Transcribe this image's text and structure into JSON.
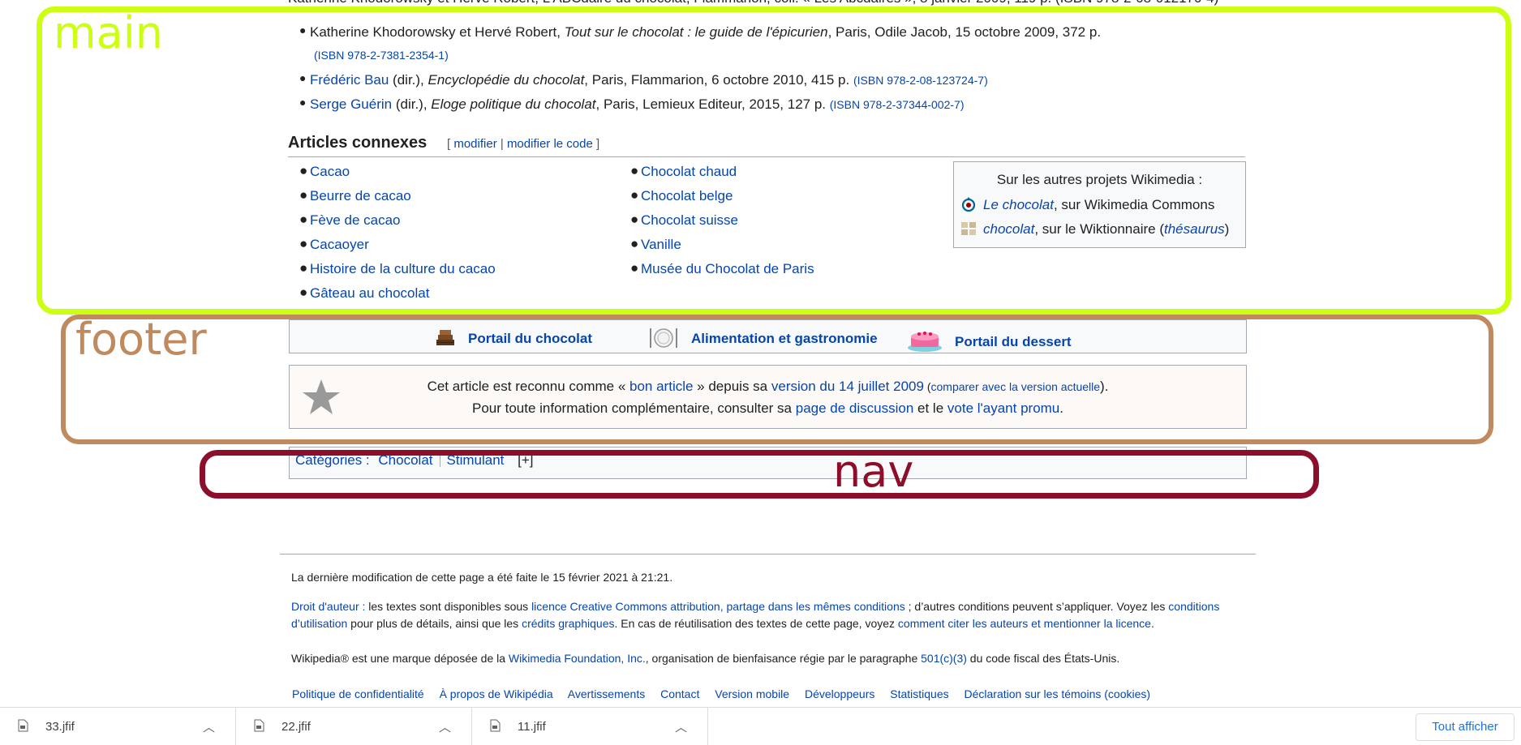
{
  "references": {
    "cut_line": "Katherine Khodorowsky et Hervé Robert, L'ABCdaire du chocolat, Flammarion, coll. « Les Abcdaires », 8 janvier 2009, 119 p. (ISBN 978-2-08-012170-4)",
    "items": [
      {
        "pre": "Katherine Khodorowsky et Hervé Robert, ",
        "title": "Tout sur le chocolat : le guide de l'épicurien",
        "post": ", Paris, Odile Jacob, 15 octobre 2009, 372 p.",
        "isbn": "(ISBN 978-2-7381-2354-1)"
      },
      {
        "author": "Frédéric Bau",
        "pre": " (dir.), ",
        "title": "Encyclopédie du chocolat",
        "post": ", Paris, Flammarion, 6 octobre 2010, 415 p. ",
        "isbn": "(ISBN 978-2-08-123724-7)"
      },
      {
        "author": "Serge Guérin",
        "pre": " (dir.), ",
        "title": "Eloge politique du chocolat",
        "post": ", Paris, Lemieux Editeur, 2015, 127 p. ",
        "isbn": "(ISBN 978-2-37344-002-7)"
      }
    ]
  },
  "articles": {
    "title": "Articles connexes",
    "edit_open": "[ ",
    "edit": "modifier",
    "edit_sep": " | ",
    "edit_code": "modifier le code",
    "edit_close": " ]",
    "col1": [
      "Cacao",
      "Beurre de cacao",
      "Fève de cacao",
      "Cacaoyer",
      "Histoire de la culture du cacao",
      "Gâteau au chocolat"
    ],
    "col2": [
      "Chocolat chaud",
      "Chocolat belge",
      "Chocolat suisse",
      "Vanille",
      "Musée du Chocolat de Paris"
    ],
    "sister": {
      "header": "Sur les autres projets Wikimedia :",
      "commons_link": "Le chocolat",
      "commons_rest": ", sur Wikimedia Commons",
      "wikt_link": "chocolat",
      "wikt_rest": ", sur le Wiktionnaire (",
      "thesaurus": "thésaurus",
      "wikt_close": ")"
    }
  },
  "portals": [
    "Portail du chocolat",
    "Alimentation et gastronomie",
    "Portail du dessert"
  ],
  "good_article": {
    "l1_a": "Cet article est reconnu comme « ",
    "l1_link": "bon article",
    "l1_b": " » depuis sa ",
    "l1_version": "version du 14 juillet 2009",
    "l1_c": " (",
    "l1_compare": "comparer avec la version actuelle",
    "l1_d": ").",
    "l2_a": "Pour toute information complémentaire, consulter sa ",
    "l2_disc": "page de discussion",
    "l2_b": " et le ",
    "l2_vote": "vote l'ayant promu",
    "l2_c": "."
  },
  "categories": {
    "label": "Catégories :",
    "items": [
      "Chocolat",
      "Stimulant"
    ],
    "expand": "[+]"
  },
  "footer": {
    "last_modified": "La dernière modification de cette page a été faite le 15 février 2021 à 21:21.",
    "license_a": "Droit d'auteur :",
    "license_b": " les textes sont disponibles sous ",
    "license_c": "licence Creative Commons attribution, partage dans les mêmes conditions",
    "license_d": " ; d’autres conditions peuvent s’appliquer. Voyez les ",
    "license_e": "conditions d’utilisation",
    "license_f": " pour plus de détails, ainsi que les ",
    "license_g": "crédits graphiques",
    "license_h": ". En cas de réutilisation des textes de cette page, voyez ",
    "license_i": "comment citer les auteurs et mentionner la licence",
    "license_j": ".",
    "trademark_a": "Wikipedia® est une marque déposée de la ",
    "trademark_b": "Wikimedia Foundation, Inc.",
    "trademark_c": ", organisation de bienfaisance régie par le paragraphe ",
    "trademark_d": "501(c)(3)",
    "trademark_e": " du code fiscal des États-Unis.",
    "links": [
      "Politique de confidentialité",
      "À propos de Wikipédia",
      "Avertissements",
      "Contact",
      "Version mobile",
      "Développeurs",
      "Statistiques",
      "Déclaration sur les témoins (cookies)"
    ]
  },
  "annotations": {
    "main": "main",
    "footer": "footer",
    "nav": "nav"
  },
  "downloads": {
    "files": [
      "33.jfif",
      "22.jfif",
      "11.jfif"
    ],
    "show_all": "Tout afficher"
  },
  "colors": {
    "link": "#0645ad",
    "main_box": "#ccff11",
    "footer_box": "#c08a5f",
    "nav_box": "#8d0e2a"
  }
}
